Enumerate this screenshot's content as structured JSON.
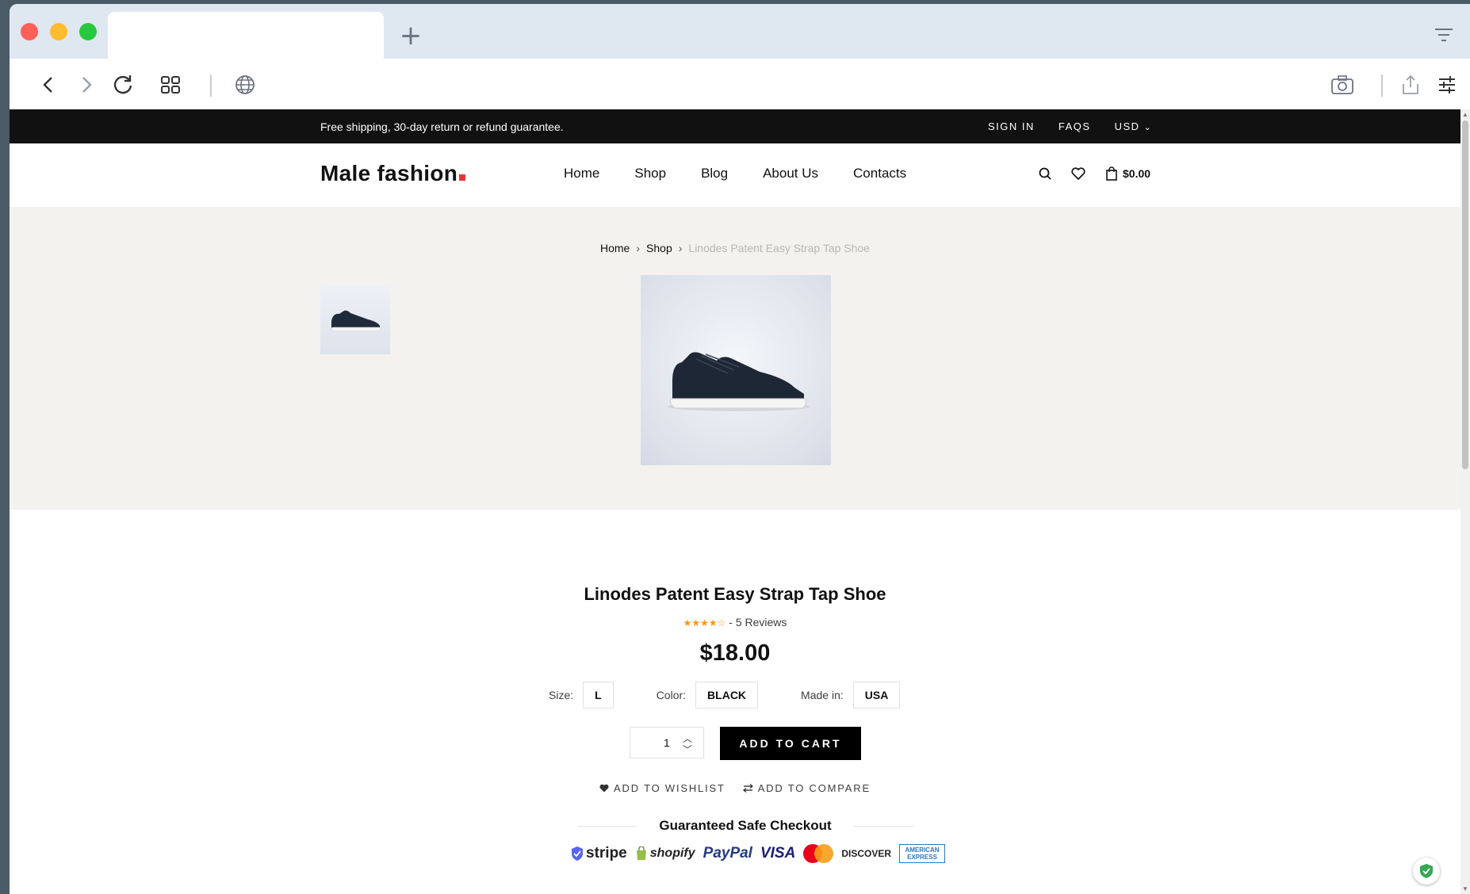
{
  "browser": {
    "tab_title": "",
    "new_tab_icon": "plus-icon",
    "colors": {
      "tabstrip": "#dfe7f1",
      "close": "#fe5f57",
      "minimize": "#febc2e",
      "maximize": "#28c840"
    }
  },
  "topbar": {
    "shipping": "Free shipping, 30-day return or refund guarantee.",
    "sign_in": "SIGN IN",
    "faqs": "FAQS",
    "currency": "USD"
  },
  "header": {
    "logo": "Male fashion",
    "nav": [
      "Home",
      "Shop",
      "Blog",
      "About Us",
      "Contacts"
    ],
    "cart_total": "$0.00",
    "accent": "#e53637"
  },
  "breadcrumb": [
    "Home",
    "Shop",
    "Linodes Patent Easy Strap Tap Shoe"
  ],
  "product": {
    "title": "Linodes Patent Easy Strap Tap Shoe",
    "rating": 4,
    "stars": "★★★★☆",
    "reviews": "- 5 Reviews",
    "price": "$18.00",
    "size_label": "Size:",
    "size": "L",
    "color_label": "Color:",
    "color": "BLACK",
    "made_label": "Made in:",
    "made_in": "USA",
    "quantity": "1",
    "add_to_cart": "ADD TO CART",
    "wishlist": "ADD TO WISHLIST",
    "compare": "ADD TO COMPARE"
  },
  "checkout": {
    "title": "Guaranteed Safe Checkout",
    "stripe": "stripe",
    "shopify": "shopify",
    "paypal": "PayPal",
    "visa": "VISA",
    "discover": "DISCOVER",
    "amex": "AMERICAN EXPRESS"
  }
}
